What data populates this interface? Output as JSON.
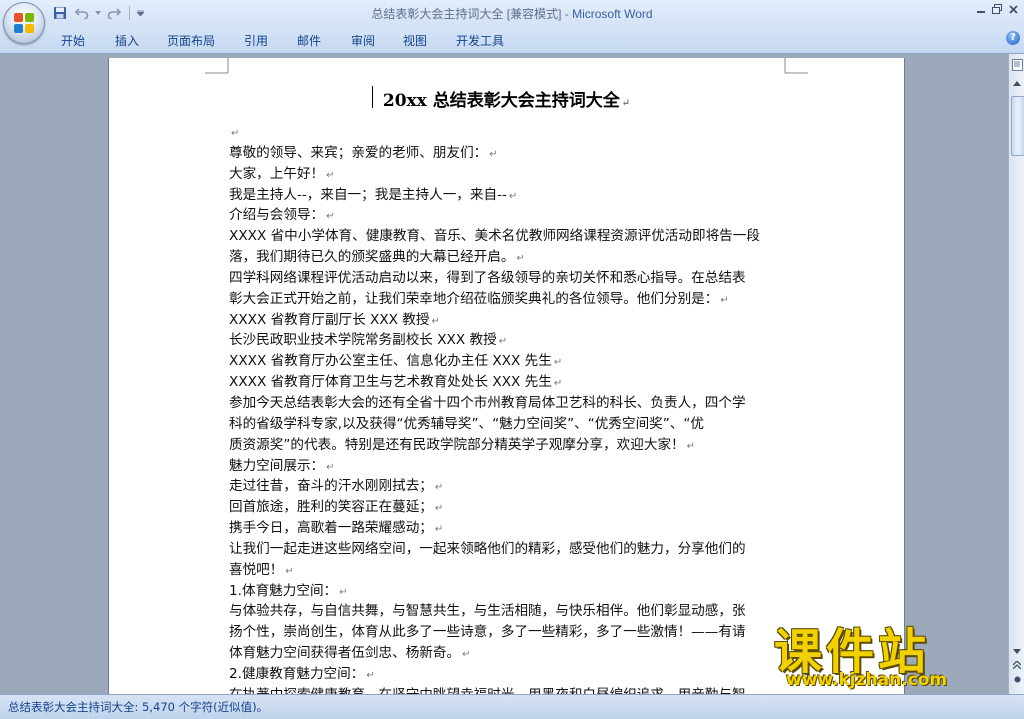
{
  "window": {
    "title": "总结表彰大会主持词大全 [兼容模式] - ",
    "app_name": "Microsoft Word"
  },
  "colors": {
    "accent": "#15428b",
    "ribbon": "#c4d8f1",
    "workspace": "#9ba9bb",
    "watermark": "#f2d100"
  },
  "ribbon": {
    "tabs": [
      "开始",
      "插入",
      "页面布局",
      "引用",
      "邮件",
      "审阅",
      "视图",
      "开发工具"
    ]
  },
  "document": {
    "title": "20xx 总结表彰大会主持词大全",
    "paragraphs": [
      "",
      "尊敬的领导、来宾；亲爱的老师、朋友们：",
      "大家，上午好！",
      "我是主持人--，来自一；我是主持人一，来自--",
      "介绍与会领导：",
      "XXXX 省中小学体育、健康教育、音乐、美术名优教师网络课程资源评优活动即将告一段",
      "落，我们期待已久的颁奖盛典的大幕已经开启。",
      "四学科网络课程评优活动启动以来，得到了各级领导的亲切关怀和悉心指导。在总结表",
      "彰大会正式开始之前，让我们荣幸地介绍莅临颁奖典礼的各位领导。他们分别是：",
      "XXXX 省教育厅副厅长 XXX 教授",
      "长沙民政职业技术学院常务副校长 XXX 教授",
      "XXXX 省教育厅办公室主任、信息化办主任 XXX 先生",
      "XXXX 省教育厅体育卫生与艺术教育处处长 XXX 先生",
      "参加今天总结表彰大会的还有全省十四个市州教育局体卫艺科的科长、负责人，四个学",
      "科的省级学科专家,以及获得“优秀辅导奖”、“魅力空间奖”、“优秀空间奖”、“优",
      "质资源奖”的代表。特别是还有民政学院部分精英学子观摩分享，欢迎大家！",
      "魅力空间展示：",
      "走过往昔，奋斗的汗水刚刚拭去；",
      "回首旅途，胜利的笑容正在蔓延；",
      "携手今日，高歌着一路荣耀感动；",
      "让我们一起走进这些网络空间，一起来领略他们的精彩，感受他们的魅力，分享他们的",
      "喜悦吧！",
      "1.体育魅力空间：",
      "与体验共存，与自信共舞，与智慧共生，与生活相随，与快乐相伴。他们彰显动感，张",
      "扬个性，崇尚创生，体育从此多了一些诗意，多了一些精彩，多了一些激情！——有请",
      "体育魅力空间获得者伍剑忠、杨新奇。",
      "2.健康教育魅力空间：",
      "在执著中探索健康教育，在坚守中眺望幸福时光。用黑夜和白昼编织追求，用辛勤与智"
    ],
    "para_marks": [
      true,
      true,
      true,
      true,
      true,
      false,
      true,
      false,
      true,
      true,
      true,
      true,
      true,
      false,
      false,
      true,
      true,
      true,
      true,
      true,
      false,
      true,
      true,
      false,
      false,
      true,
      true,
      false
    ]
  },
  "status": {
    "text": "总结表彰大会主持词大全: 5,470 个字符(近似值)。"
  },
  "watermark": {
    "logo_text": "课件站",
    "url": "www.kjzhan.com"
  }
}
